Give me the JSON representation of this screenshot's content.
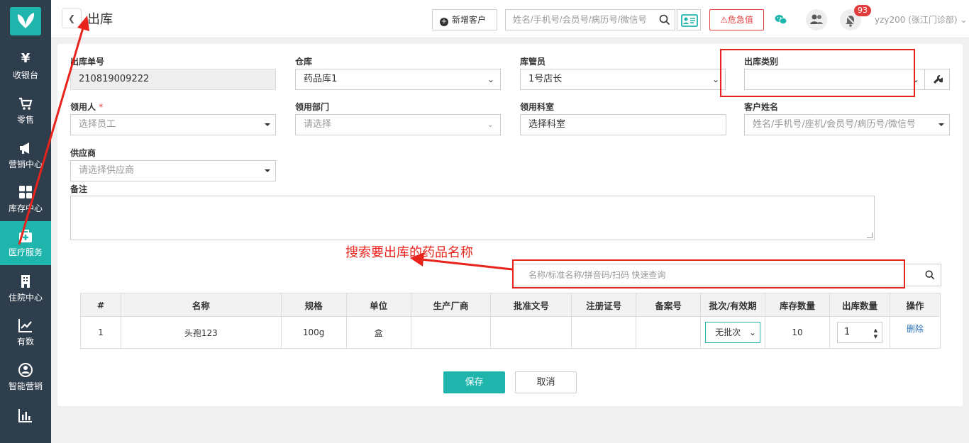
{
  "sidebar": {
    "items": [
      {
        "label": "收银台",
        "icon": "yen-icon"
      },
      {
        "label": "零售",
        "icon": "cart-icon"
      },
      {
        "label": "营销中心",
        "icon": "megaphone-icon"
      },
      {
        "label": "库存中心",
        "icon": "grid-icon"
      },
      {
        "label": "医疗服务",
        "icon": "medkit-icon",
        "active": true
      },
      {
        "label": "住院中心",
        "icon": "building-icon"
      },
      {
        "label": "有数",
        "icon": "trend-icon"
      },
      {
        "label": "智能营销",
        "icon": "people-icon"
      },
      {
        "label": "",
        "icon": "bar-chart-icon"
      }
    ],
    "yen_glyph": "¥"
  },
  "header": {
    "title": "出库",
    "new_customer": "新增客户",
    "search_placeholder": "姓名/手机号/会员号/病历号/微信号",
    "danger_label": "危急值",
    "notif_count": "93",
    "user": "yzy200 (张江门诊部)"
  },
  "form": {
    "order_no_label": "出库单号",
    "order_no": "210819009222",
    "warehouse_label": "仓库",
    "warehouse": "药品库1",
    "keeper_label": "库管员",
    "keeper": "1号店长",
    "category_label": "出库类别",
    "category": "",
    "receiver_label": "领用人",
    "required_mark": "*",
    "receiver_placeholder": "选择员工",
    "dept_label": "领用部门",
    "dept_placeholder": "请选择",
    "section_label": "领用科室",
    "section_placeholder": "选择科室",
    "customer_label": "客户姓名",
    "customer_placeholder": "姓名/手机号/座机/会员号/病历号/微信号",
    "supplier_label": "供应商",
    "supplier_placeholder": "请选择供应商",
    "remark_label": "备注"
  },
  "drug_search": {
    "placeholder": "名称/标准名称/拼音码/扫码 快速查询"
  },
  "table": {
    "headers": [
      "#",
      "名称",
      "规格",
      "单位",
      "生产厂商",
      "批准文号",
      "注册证号",
      "备案号",
      "批次/有效期",
      "库存数量",
      "出库数量",
      "操作"
    ],
    "rows": [
      {
        "no": "1",
        "name": "头孢123",
        "spec": "100g",
        "unit": "盒",
        "maker": "",
        "approval": "",
        "reg": "",
        "record": "",
        "batch": "无批次",
        "stock": "10",
        "qty": "1",
        "action": "删除"
      }
    ]
  },
  "actions": {
    "save": "保存",
    "cancel": "取消"
  },
  "annotation": {
    "text": "搜索要出库的药品名称",
    "color": "#e8231b"
  },
  "colors": {
    "accent": "#1fb5ac",
    "sidebar": "#2f3e4d",
    "danger": "#e23c3c"
  }
}
